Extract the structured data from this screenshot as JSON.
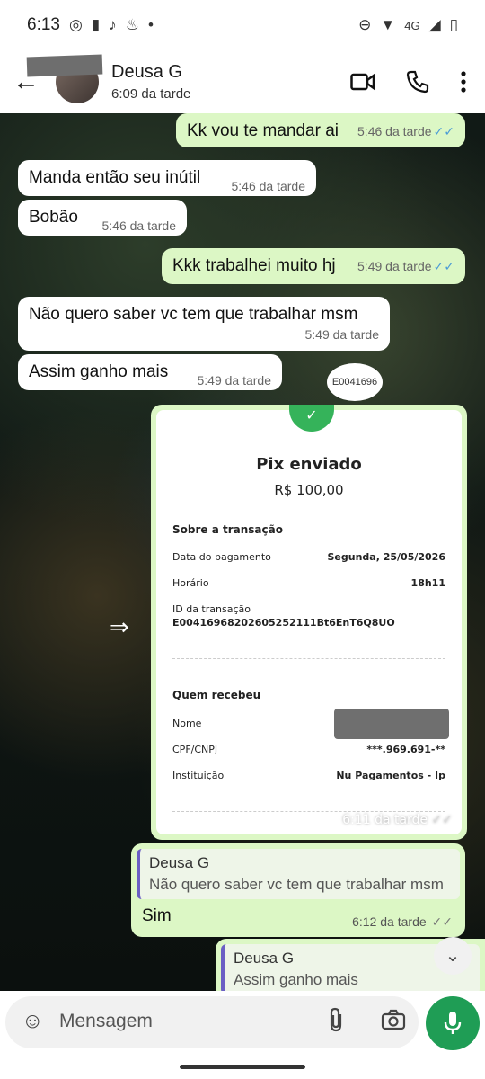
{
  "status_bar": {
    "time": "6:13",
    "network": "4G"
  },
  "header": {
    "name": "Deusa G",
    "status": "6:09 da tarde"
  },
  "messages": [
    {
      "text": "Kk vou te mandar ai",
      "time": "5:46 da tarde"
    },
    {
      "text": "Manda então seu inútil",
      "time": "5:46 da tarde"
    },
    {
      "text": "Bobão",
      "time": "5:46 da tarde"
    },
    {
      "text": "Kkk trabalhei muito hj",
      "time": "5:49 da tarde"
    },
    {
      "text": "Não quero saber vc tem que trabalhar msm",
      "time": "5:49 da tarde"
    },
    {
      "text": "Assim ganho mais",
      "time": "5:49 da tarde"
    }
  ],
  "pix": {
    "title": "Pix enviado",
    "amount": "R$ 100,00",
    "section1": "Sobre a transação",
    "date_label": "Data do pagamento",
    "date_value": "Segunda, 25/05/2026",
    "hour_label": "Horário",
    "hour_value": "18h11",
    "id_label": "ID da transação",
    "id_value": "E00416968202605252111Bt6EnT6Q8UO",
    "section2": "Quem recebeu",
    "name_label": "Nome",
    "cpf_label": "CPF/CNPJ",
    "cpf_value": "***.969.691-**",
    "inst_label": "Instituição",
    "inst_value": "Nu Pagamentos - Ip",
    "time": "6:11 da tarde",
    "overflow_text": "E0041696"
  },
  "reply1": {
    "quote_name": "Deusa G",
    "quote_text": "Não quero saber vc tem que trabalhar msm",
    "text": "Sim",
    "time": "6:12 da tarde"
  },
  "reply2": {
    "quote_name": "Deusa G",
    "quote_text": "Assim ganho mais"
  },
  "input": {
    "placeholder": "Mensagem"
  }
}
